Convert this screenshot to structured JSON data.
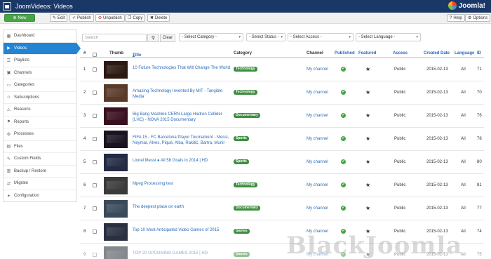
{
  "header": {
    "title": "JoomVideos:  Videos",
    "logo_text": "Joomla!"
  },
  "toolbar": {
    "new": "New",
    "edit": "Edit",
    "publish": "Publish",
    "unpublish": "Unpublish",
    "copy": "Copy",
    "delete": "Delete",
    "help": "Help",
    "options": "Options"
  },
  "sidebar": {
    "items": [
      {
        "label": "Dashboard",
        "icon": "dashboard-icon"
      },
      {
        "label": "Videos",
        "icon": "video-icon"
      },
      {
        "label": "Playlists",
        "icon": "list-icon"
      },
      {
        "label": "Channels",
        "icon": "channel-icon"
      },
      {
        "label": "Categories",
        "icon": "folder-icon"
      },
      {
        "label": "Subscriptions",
        "icon": "users-icon"
      },
      {
        "label": "Reasons",
        "icon": "warning-icon"
      },
      {
        "label": "Reports",
        "icon": "flag-icon"
      },
      {
        "label": "Processes",
        "icon": "gear-icon"
      },
      {
        "label": "Files",
        "icon": "file-icon"
      },
      {
        "label": "Custom Fields",
        "icon": "edit-icon"
      },
      {
        "label": "Backup / Restore",
        "icon": "archive-icon"
      },
      {
        "label": "Migrate",
        "icon": "migrate-icon"
      },
      {
        "label": "Configuration",
        "icon": "config-icon"
      }
    ]
  },
  "filters": {
    "search_placeholder": "Search",
    "clear": "Clear",
    "category": "- Select Category -",
    "status": "- Select Status -",
    "access": "- Select Access -",
    "language": "- Select Language -"
  },
  "table": {
    "headers": {
      "num": "#",
      "thumb": "Thumb",
      "title": "Title",
      "category": "Category",
      "channel": "Channel",
      "published": "Published",
      "featured": "Featured",
      "access": "Access",
      "created": "Created Date",
      "language": "Language",
      "id": "ID"
    },
    "rows": [
      {
        "num": "1",
        "title": "10 Future Technologies That Will Change The World",
        "category": "Technology",
        "channel": "My channel",
        "access": "Public",
        "date": "2015-02-13",
        "language": "All",
        "id": "71",
        "thumb_color": "#2c1a12"
      },
      {
        "num": "2",
        "title": "Amazing Technology Invented By MIT - Tangible Media",
        "category": "Technology",
        "channel": "My channel",
        "access": "Public",
        "date": "2015-02-13",
        "language": "All",
        "id": "70",
        "thumb_color": "#5a3a2a"
      },
      {
        "num": "3",
        "title": "Big Bang Machine CERN Large Hadron Collider (LHC) - NOVA 2015 Documentary",
        "category": "Documentary",
        "channel": "My channel",
        "access": "Public",
        "date": "2015-02-13",
        "language": "All",
        "id": "76",
        "thumb_color": "#3a1020"
      },
      {
        "num": "4",
        "title": "FIFA 15 - FC Barcelona Player Tournament - Messi, Neymar, Alves, Piqué, Alba, Rakitić, Bartra, Munir",
        "category": "Sports",
        "channel": "My channel",
        "access": "Public",
        "date": "2015-02-13",
        "language": "All",
        "id": "78",
        "thumb_color": "#1a1420"
      },
      {
        "num": "5",
        "title": "Lionel Messi ● All 58 Goals in 2014 | HD",
        "category": "Sports",
        "channel": "My channel",
        "access": "Public",
        "date": "2015-02-13",
        "language": "All",
        "id": "80",
        "thumb_color": "#222a44"
      },
      {
        "num": "6",
        "title": "Mpeg Processing test",
        "category": "Technology",
        "channel": "My channel",
        "access": "Public",
        "date": "2015-02-13",
        "language": "All",
        "id": "81",
        "thumb_color": "#3a3a3a"
      },
      {
        "num": "7",
        "title": "The deepest place on earth",
        "category": "Documentary",
        "channel": "My channel",
        "access": "Public",
        "date": "2015-02-13",
        "language": "All",
        "id": "77",
        "thumb_color": "#3a4a5a"
      },
      {
        "num": "8",
        "title": "Top 10 Most Anticipated Video Games of 2015",
        "category": "Games",
        "channel": "My channel",
        "access": "Public",
        "date": "2015-02-13",
        "language": "All",
        "id": "74",
        "thumb_color": "#2a3040"
      },
      {
        "num": "9",
        "title": "TOP 20 UPCOMING GAMES 2015 | HD",
        "category": "Games",
        "channel": "My channel",
        "access": "Public",
        "date": "2015-02-13",
        "language": "All",
        "id": "75",
        "thumb_color": "#202830"
      }
    ]
  },
  "colors": {
    "accent": "#2384d3",
    "header": "#1a3867",
    "label_green": "#3e8e41",
    "published_green": "#46a546"
  },
  "watermark": "BlackJoomla"
}
